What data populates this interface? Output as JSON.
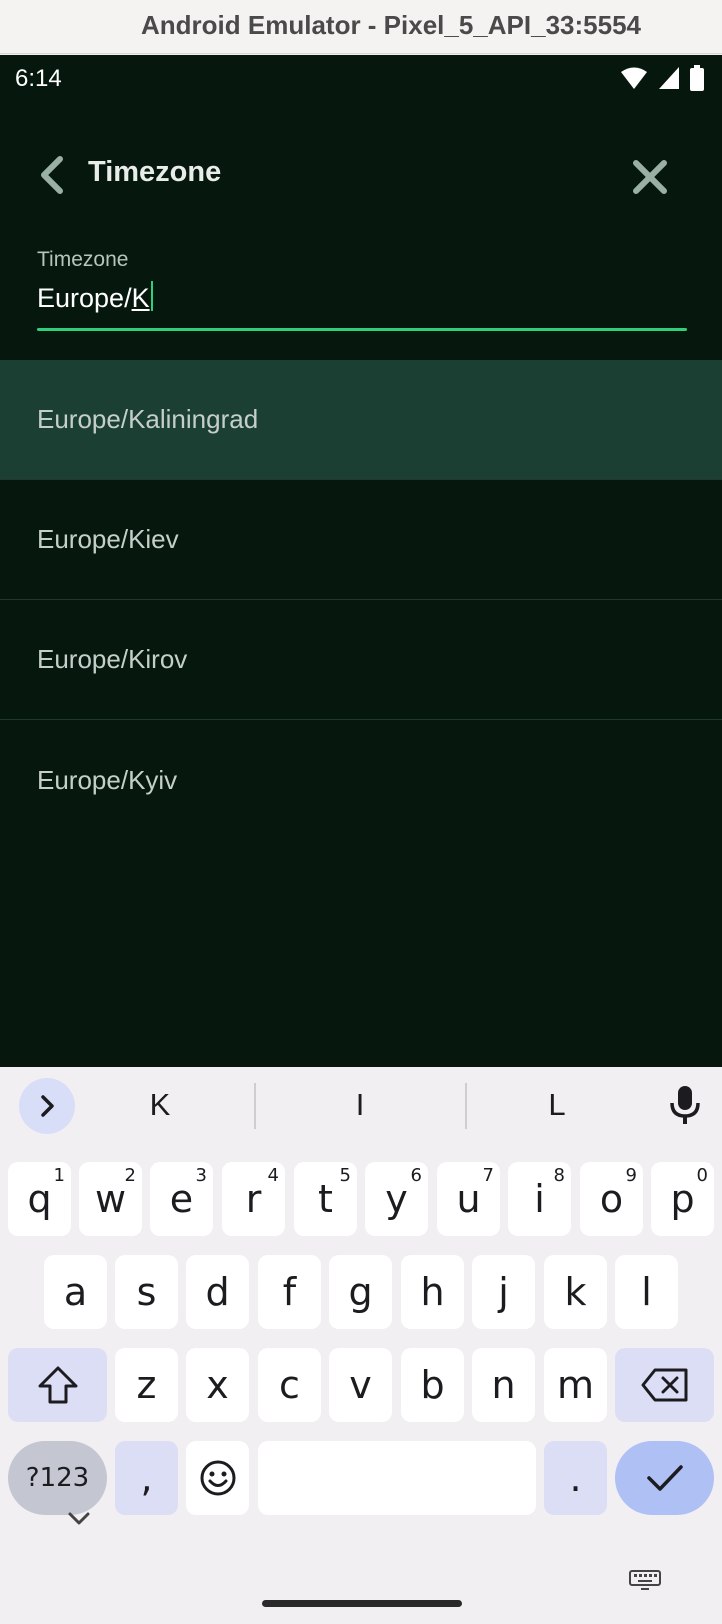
{
  "window": {
    "title": "Android Emulator - Pixel_5_API_33:5554"
  },
  "status_bar": {
    "time": "6:14",
    "icons": [
      "wifi-icon",
      "cell-signal-icon",
      "battery-icon"
    ]
  },
  "app_bar": {
    "title": "Timezone",
    "back_icon": "chevron-left-icon",
    "close_icon": "close-icon"
  },
  "search_field": {
    "label": "Timezone",
    "value_prefix": "Europe/",
    "value_composing": "K",
    "accent_color": "#2fd07c"
  },
  "results": [
    {
      "label": "Europe/Kaliningrad",
      "selected": true
    },
    {
      "label": "Europe/Kiev",
      "selected": false
    },
    {
      "label": "Europe/Kirov",
      "selected": false
    },
    {
      "label": "Europe/Kyiv",
      "selected": false
    }
  ],
  "keyboard": {
    "suggestions": [
      "K",
      "I",
      "L"
    ],
    "row1": [
      {
        "key": "q",
        "hint": "1"
      },
      {
        "key": "w",
        "hint": "2"
      },
      {
        "key": "e",
        "hint": "3"
      },
      {
        "key": "r",
        "hint": "4"
      },
      {
        "key": "t",
        "hint": "5"
      },
      {
        "key": "y",
        "hint": "6"
      },
      {
        "key": "u",
        "hint": "7"
      },
      {
        "key": "i",
        "hint": "8"
      },
      {
        "key": "o",
        "hint": "9"
      },
      {
        "key": "p",
        "hint": "0"
      }
    ],
    "row2": [
      "a",
      "s",
      "d",
      "f",
      "g",
      "h",
      "j",
      "k",
      "l"
    ],
    "row3": [
      "z",
      "x",
      "c",
      "v",
      "b",
      "n",
      "m"
    ],
    "symbols_label": "?123",
    "comma_label": ",",
    "period_label": "."
  }
}
